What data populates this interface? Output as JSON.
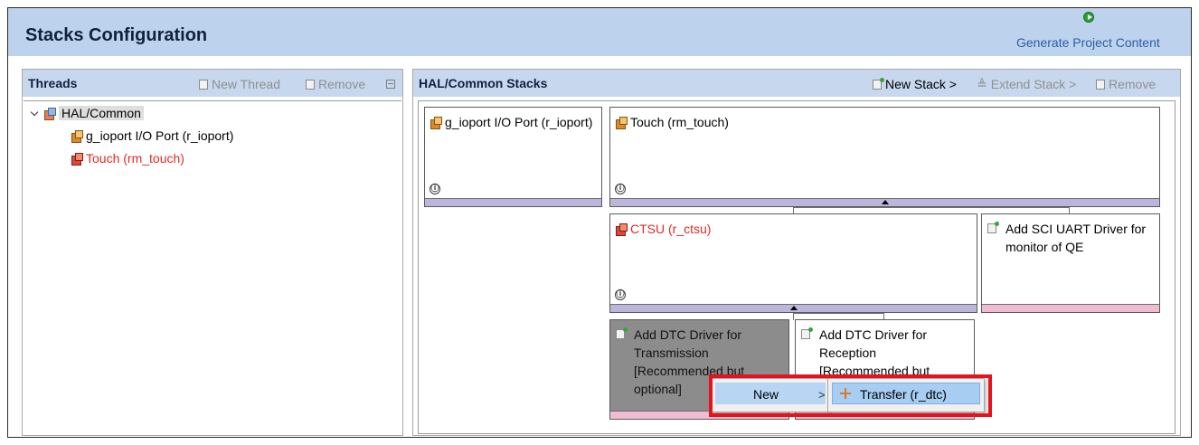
{
  "header": {
    "title": "Stacks Configuration",
    "generate_label": "Generate Project Content"
  },
  "threads": {
    "title": "Threads",
    "new_thread_label": "New Thread",
    "remove_label": "Remove",
    "tree": {
      "root_label": "HAL/Common",
      "children": [
        {
          "label": "g_ioport I/O Port (r_ioport)",
          "status": "ok"
        },
        {
          "label": "Touch (rm_touch)",
          "status": "error"
        }
      ]
    }
  },
  "stacks": {
    "title": "HAL/Common Stacks",
    "new_stack_label": "New Stack >",
    "extend_stack_label": "Extend Stack >",
    "remove_label": "Remove",
    "blocks": {
      "ioport": "g_ioport I/O Port (r_ioport)",
      "touch": "Touch (rm_touch)",
      "ctsu": "CTSU (r_ctsu)",
      "sci_uart": "Add SCI UART Driver for monitor of QE",
      "dtc_tx": "Add DTC Driver for Transmission [Recommended but optional]",
      "dtc_rx": "Add DTC Driver for Reception [Recommended but optional]"
    },
    "info_glyph": "ⓘ"
  },
  "context_menu": {
    "new_label": "New",
    "submenu_item": "Transfer (r_dtc)"
  },
  "colors": {
    "error_text": "#e02a20",
    "header_bg": "#bdd2ec",
    "highlight": "#e8121c"
  }
}
